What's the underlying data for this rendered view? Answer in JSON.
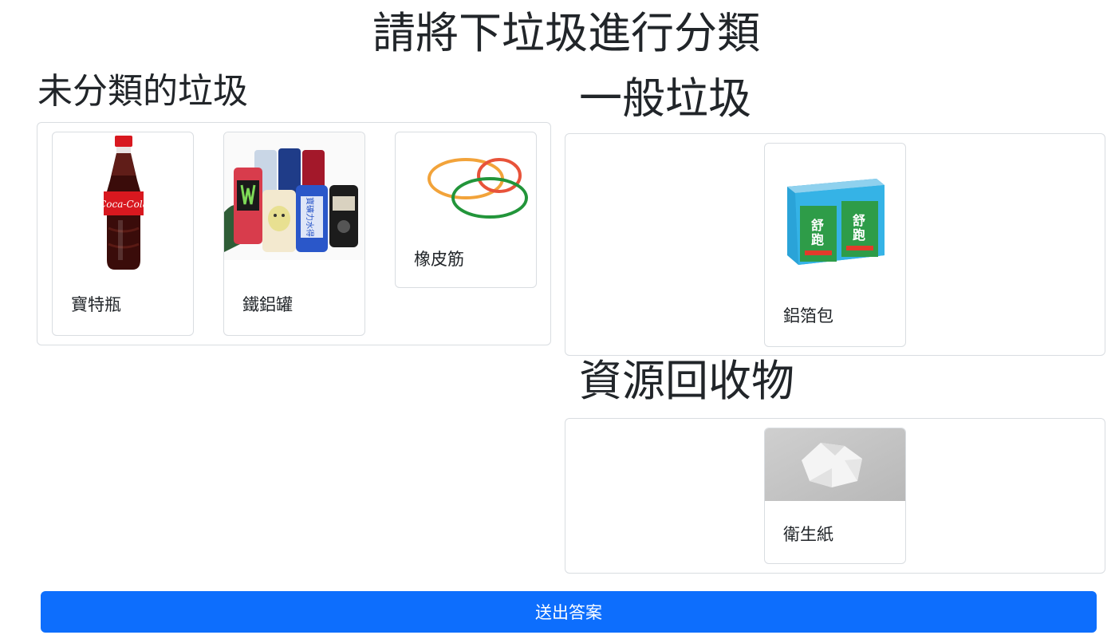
{
  "title": "請將下垃圾進行分類",
  "sections": {
    "unsorted": {
      "title": "未分類的垃圾"
    },
    "general": {
      "title": "一般垃圾"
    },
    "recycle": {
      "title": "資源回收物"
    }
  },
  "cards": {
    "bottle": {
      "label": "寶特瓶",
      "icon": "cola-bottle-photo"
    },
    "cans": {
      "label": "鐵鋁罐",
      "icon": "drink-cans-photo"
    },
    "rubber": {
      "label": "橡皮筋",
      "icon": "rubber-bands-photo"
    },
    "foil": {
      "label": "鋁箔包",
      "icon": "juice-box-pack-photo"
    },
    "tissue": {
      "label": "衛生紙",
      "icon": "crumpled-tissue-photo"
    }
  },
  "submit_label": "送出答案",
  "colors": {
    "accent": "#0d6efd",
    "border": "#d9dde1"
  }
}
